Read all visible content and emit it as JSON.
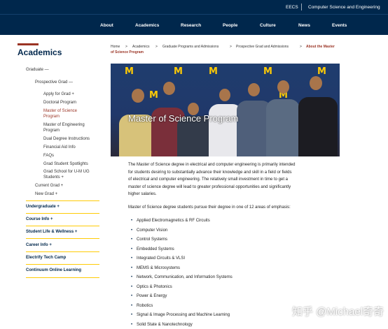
{
  "topbar": {
    "eecs": "EECS",
    "dept": "Computer Science and Engineering"
  },
  "nav": [
    "About",
    "Academics",
    "Research",
    "People",
    "Culture",
    "News",
    "Events"
  ],
  "sidebar": {
    "title": "Academics",
    "items": [
      "Graduate —",
      "Prospective Grad —",
      "Apply for Grad +",
      "Doctoral Program",
      "Master of Science",
      "Program",
      "Master of Engineering",
      "Program",
      "Dual Degree Instructions",
      "Financial Aid Info",
      "FAQs",
      "Grad Student Spotlights",
      "Grad School for U-M UG",
      "Students +",
      "Current Grad +",
      "New Grad +",
      "Undergraduate +",
      "Course Info +",
      "Student Life & Wellness +",
      "Career Info +",
      "Electrify Tech Camp",
      "Continuum Online Learning"
    ]
  },
  "breadcrumb": [
    "Home",
    ">",
    "Academics",
    ">",
    "Graduate Programs and Admissions",
    ">",
    "Prospective Grad and Admissions",
    ">",
    "About the Master",
    "of Science Program"
  ],
  "hero": {
    "title": "Master of Science Program"
  },
  "content": {
    "intro": [
      "The Master of Science degree in electrical and computer engineering is primarily intended",
      "for students desiring to substantially advance their knowledge and skill in a field or fields",
      "of electrical and computer engineering. The relatively small investment in time to get a",
      "master of science degree will lead to greater professional opportunities and significantly",
      "higher salaries."
    ],
    "areas_intro": "Master of Science degree students pursue their degree in one of 12 areas of emphasis:",
    "areas": [
      "Applied Electromagnetics & RF Circuits",
      "Computer Vision",
      "Control Systems",
      "Embedded Systems",
      "Integrated Circuits & VLSI",
      "MEMS & Microsystems",
      "Network, Communication, and Information Systems",
      "Optics & Photonics",
      "Power & Energy",
      "Robotics",
      "Signal & Image Processing and Machine Learning",
      "Solid State & Nanotechnology"
    ]
  },
  "watermark": "知乎 @Michael奇奇"
}
